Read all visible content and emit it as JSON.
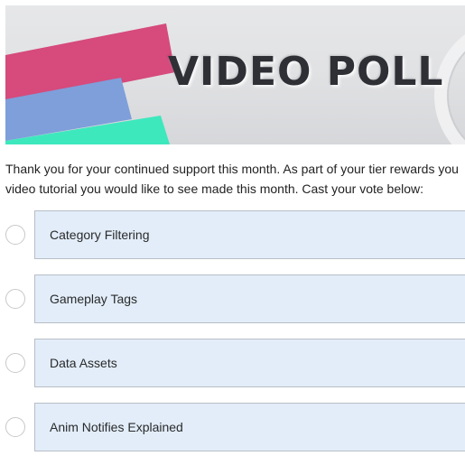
{
  "banner": {
    "title": "VIDEO POLL"
  },
  "intro": {
    "line1": "Thank you for your continued support this month. As part of your tier rewards you",
    "line2": "video tutorial you would like to see made this month. Cast your vote below:"
  },
  "poll": {
    "options": [
      {
        "label": "Category Filtering",
        "selected": false
      },
      {
        "label": "Gameplay Tags",
        "selected": false
      },
      {
        "label": "Data Assets",
        "selected": false
      },
      {
        "label": "Anim Notifies Explained",
        "selected": false
      }
    ]
  },
  "colors": {
    "stripe_pink": "#d64a7c",
    "stripe_blue": "#7e9fda",
    "stripe_green": "#3de8bd",
    "option_bg": "#e2edf9",
    "banner_text": "#2e3036"
  }
}
